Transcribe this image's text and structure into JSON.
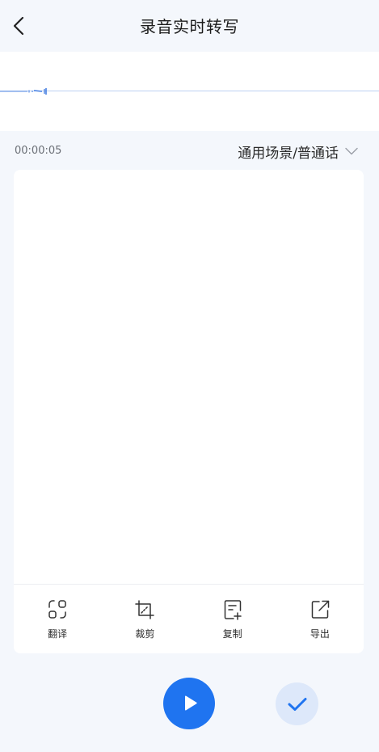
{
  "header": {
    "title": "录音实时转写",
    "back_icon": "chevron-left-icon"
  },
  "recording": {
    "elapsed": "00:00:05",
    "scene": "通用场景/普通话"
  },
  "toolbar": {
    "items": [
      {
        "label": "翻译",
        "icon": "translate-icon"
      },
      {
        "label": "裁剪",
        "icon": "crop-icon"
      },
      {
        "label": "复制",
        "icon": "copy-icon"
      },
      {
        "label": "导出",
        "icon": "export-icon"
      }
    ]
  },
  "controls": {
    "play_icon": "play-icon",
    "confirm_icon": "check-icon"
  },
  "colors": {
    "accent": "#1f74f0",
    "accent_light": "#dde8fa",
    "background": "#f4f7fc",
    "card": "#ffffff"
  }
}
